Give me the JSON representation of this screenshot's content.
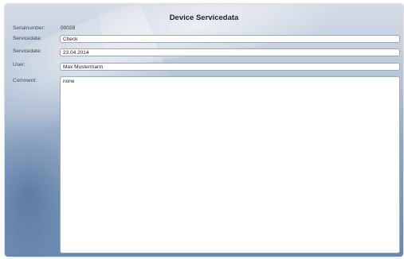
{
  "window": {
    "title": "Device Servicedata"
  },
  "form": {
    "serialnumber_label": "Serialnumber:",
    "serialnumber_value": "00028",
    "servicedata_label": "Servicedata:",
    "servicedata_value": "Check",
    "servicedate_label": "Servicedate:",
    "servicedate_value": "23.04.2014",
    "user_label": "User:",
    "user_value": "Max Mustermann",
    "comment_label": "Comment:",
    "comment_value": "none"
  }
}
